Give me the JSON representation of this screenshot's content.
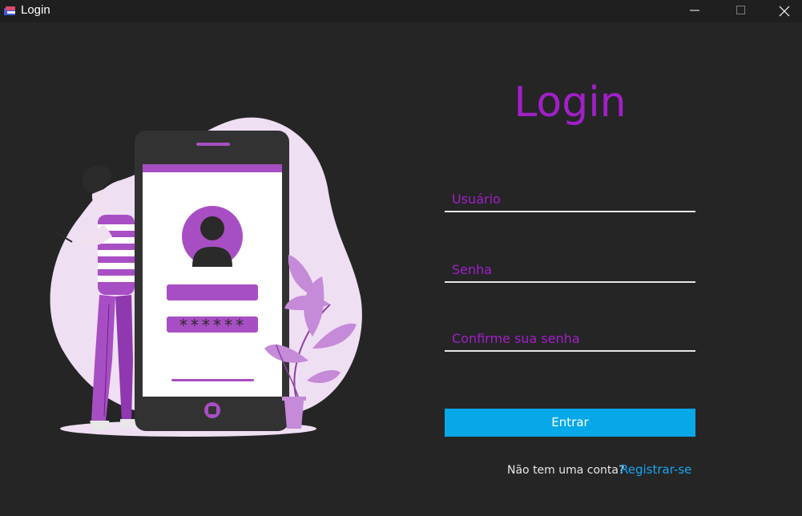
{
  "window": {
    "title": "Login",
    "icon": "app-logo-icon",
    "controls": [
      "minimize-icon",
      "maximize-icon",
      "close-icon"
    ]
  },
  "form": {
    "heading": "Login",
    "username_placeholder": "Usuário",
    "password_placeholder": "Senha",
    "confirm_placeholder": "Confirme sua senha",
    "submit_label": "Entrar",
    "no_account_text": "Não tem uma conta?",
    "register_link": "Registrar-se"
  },
  "illustration": {
    "password_mask": "******"
  },
  "colors": {
    "background": "#252526",
    "accent": "#a21fc8",
    "button": "#06a8e8",
    "link": "#19a6ee"
  }
}
